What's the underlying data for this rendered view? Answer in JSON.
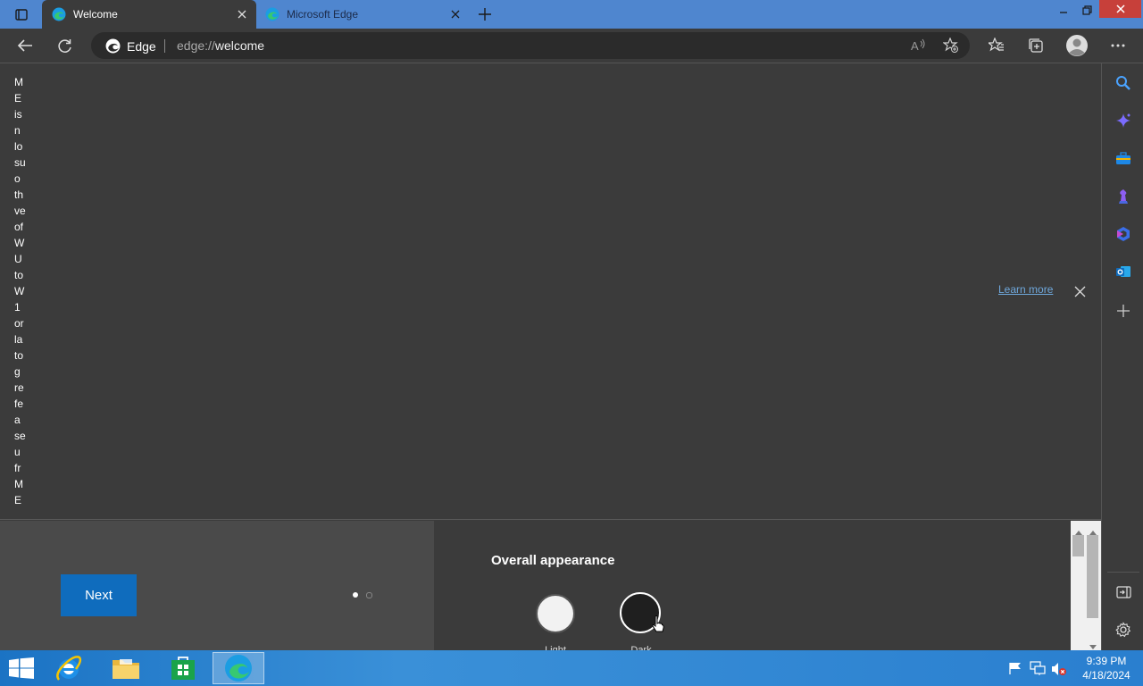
{
  "browser": {
    "tabs": [
      {
        "title": "Welcome",
        "active": true
      },
      {
        "title": "Microsoft Edge",
        "active": false
      }
    ],
    "address": {
      "brand": "Edge",
      "scheme": "edge://",
      "path": "welcome"
    }
  },
  "content": {
    "infobar_vertical_text": [
      "M",
      "E",
      "is",
      "n",
      "lo",
      "su",
      "o",
      "th",
      "ve",
      "of",
      "W",
      "U",
      "to",
      "W",
      "1",
      "or",
      "la",
      "to",
      "g",
      "re",
      "fe",
      "a",
      "se",
      "u",
      "fr",
      "M",
      "E"
    ],
    "learn_more": "Learn more",
    "next_button": "Next",
    "appearance_title": "Overall appearance",
    "themes": [
      {
        "label": "Light",
        "color": "#f2f2f2"
      },
      {
        "label": "Dark",
        "color": "#1f1f1f"
      }
    ],
    "pagination": {
      "current": 1,
      "total": 2
    }
  },
  "taskbar": {
    "time": "9:39 PM",
    "date": "4/18/2024"
  },
  "colors": {
    "accent": "#0f6cbd",
    "tabstrip": "#4f86cf",
    "content_bg": "#3b3b3b"
  }
}
